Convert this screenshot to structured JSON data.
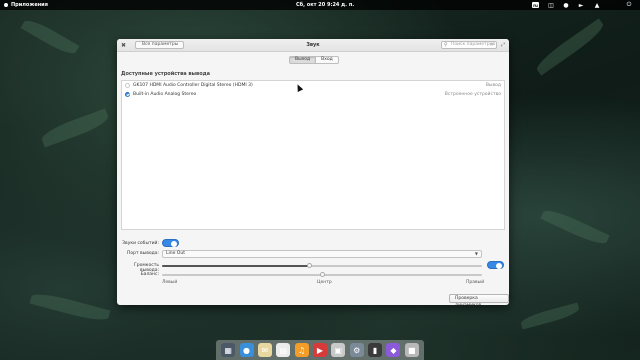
{
  "panel": {
    "applications_label": "Приложения",
    "clock": "Сб, окт 20   9:24 д. п.",
    "badge": "ru",
    "indicators": [
      "keyboard-layout-icon",
      "notifications-icon",
      "microphone-icon",
      "volume-icon",
      "network-icon",
      "power-icon"
    ]
  },
  "window": {
    "title": "Звук",
    "back_button": "Все параметры",
    "search_placeholder": "Поиск параметров",
    "tabs": [
      "Выход",
      "Вход"
    ],
    "active_tab": "Выход",
    "section_title": "Доступные устройства вывода",
    "devices": [
      {
        "name": "GK107 HDMI Audio Controller Digital Stereo (HDMI 3)",
        "meta": "Вывод",
        "selected": false
      },
      {
        "name": "Built-in Audio Analog Stereo",
        "meta": "Встроенное устройство",
        "selected": true
      }
    ],
    "event_sounds_label": "Звуки событий:",
    "event_sounds_on": true,
    "port_label": "Порт вывода:",
    "port_value": "Line Out",
    "volume_label": "Громкость вывода:",
    "volume_level_percent": 46,
    "volume_enabled": true,
    "balance_label": "Баланс:",
    "balance_level_percent": 50,
    "balance_left": "Левый",
    "balance_center": "Центр",
    "balance_right": "Правый",
    "test_button": "Проверка динамиков..."
  },
  "dock": {
    "apps": [
      {
        "icon": "multitasking-view-icon",
        "color": "#4a5868"
      },
      {
        "icon": "web-browser-icon",
        "color": "#3a8fd9"
      },
      {
        "icon": "mail-icon",
        "color": "#e8d7a0"
      },
      {
        "icon": "calendar-icon",
        "color": "#ececec"
      },
      {
        "icon": "music-icon",
        "color": "#f39c28"
      },
      {
        "icon": "videos-icon",
        "color": "#d83a3a"
      },
      {
        "icon": "photos-icon",
        "color": "#c9c9c9"
      },
      {
        "icon": "system-settings-icon",
        "color": "#7a8a98"
      },
      {
        "icon": "terminal-icon",
        "color": "#3a3a3a"
      },
      {
        "icon": "app-center-icon",
        "color": "#8a5ad8"
      },
      {
        "icon": "files-icon",
        "color": "#b8b8b8"
      }
    ]
  }
}
